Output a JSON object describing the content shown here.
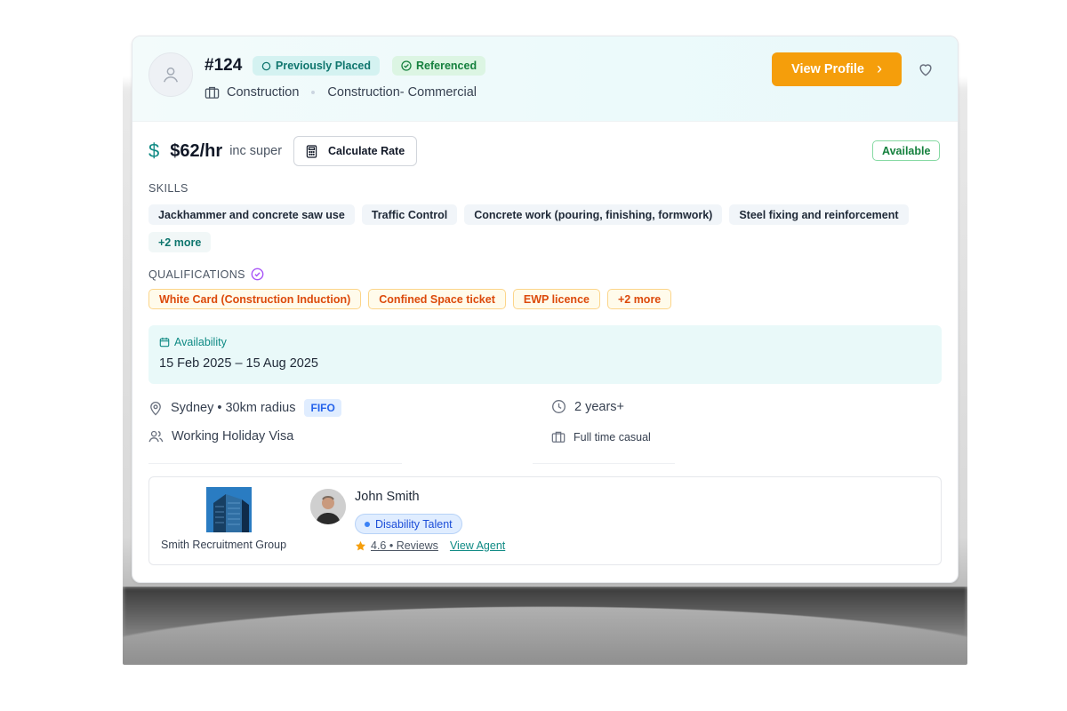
{
  "candidate": {
    "id": "#124",
    "badges": {
      "placed": "Previously Placed",
      "referenced": "Referenced"
    },
    "industry": "Construction",
    "sector": "Construction- Commercial",
    "view_profile_label": "View Profile",
    "view_profile_chevron": "›"
  },
  "rate": {
    "currency_symbol": "$",
    "value": "$62/hr",
    "note": "inc super",
    "calculate_label": "Calculate Rate",
    "status": "Available"
  },
  "skills": {
    "label": "SKILLS",
    "items": [
      "Jackhammer and concrete saw use",
      "Traffic Control",
      "Concrete work (pouring, finishing, formwork)",
      "Steel fixing and reinforcement"
    ],
    "more": "+2 more"
  },
  "qualifications": {
    "label": "QUALIFICATIONS",
    "items": [
      "White Card (Construction Induction)",
      "Confined Space ticket",
      "EWP licence"
    ],
    "more": "+2 more"
  },
  "availability": {
    "title": "Availability",
    "dates": "15 Feb 2025 – 15 Aug 2025"
  },
  "details": {
    "location": "Sydney • 30km radius",
    "fifo": "FIFO",
    "experience": "2 years+",
    "visa": "Working Holiday Visa",
    "employment": "Full time casual"
  },
  "agency": {
    "name": "Smith Recruitment Group",
    "agent_name": "John Smith",
    "agent_tag": "Disability Talent",
    "rating": "4.6",
    "reviews_label": "4.6 • Reviews",
    "view_agent_label": "View Agent"
  },
  "colors": {
    "accent_orange": "#f59e0b",
    "teal": "#0f8a84",
    "available_green": "#15803d",
    "qualification_orange": "#dc4a0b"
  }
}
